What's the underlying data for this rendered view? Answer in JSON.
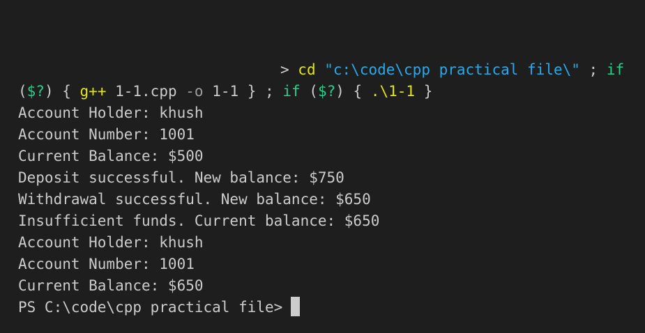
{
  "terminal": {
    "command": {
      "line1": [
        {
          "t": "> ",
          "c": "default"
        },
        {
          "t": "cd",
          "c": "cmd"
        },
        {
          "t": " ",
          "c": "default"
        },
        {
          "t": "\"c:\\code\\cpp practical file\\\"",
          "c": "string"
        },
        {
          "t": " ; ",
          "c": "default"
        },
        {
          "t": "if",
          "c": "keyword"
        }
      ],
      "line2": [
        {
          "t": "(",
          "c": "default"
        },
        {
          "t": "$?",
          "c": "var"
        },
        {
          "t": ") { ",
          "c": "default"
        },
        {
          "t": "g++",
          "c": "cmd"
        },
        {
          "t": " 1-1.cpp ",
          "c": "default"
        },
        {
          "t": "-o",
          "c": "flag"
        },
        {
          "t": " 1-1 } ; ",
          "c": "default"
        },
        {
          "t": "if",
          "c": "keyword"
        },
        {
          "t": " (",
          "c": "default"
        },
        {
          "t": "$?",
          "c": "var"
        },
        {
          "t": ") { ",
          "c": "default"
        },
        {
          "t": ".\\1-1",
          "c": "cmd"
        },
        {
          "t": " }",
          "c": "default"
        }
      ]
    },
    "output": [
      "Account Holder: khush",
      "Account Number: 1001",
      "Current Balance: $500",
      "Deposit successful. New balance: $750",
      "Withdrawal successful. New balance: $650",
      "Insufficient funds. Current balance: $650",
      "Account Holder: khush",
      "Account Number: 1001",
      "Current Balance: $650"
    ],
    "prompt": "PS C:\\code\\cpp practical file>",
    "colors": {
      "background": "#1e1e1e",
      "text": "#cccccc",
      "command": "#e5e510",
      "string": "#2aa9e8",
      "keyword": "#23d18b",
      "flag": "#9d9d9d"
    }
  }
}
